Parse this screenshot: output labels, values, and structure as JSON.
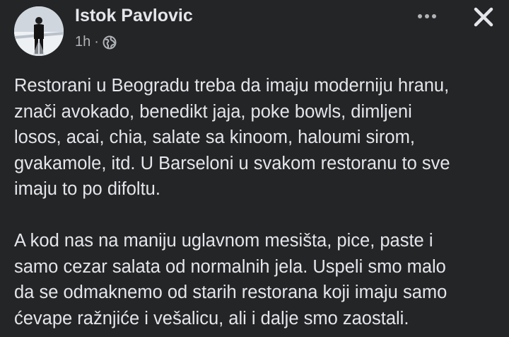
{
  "post": {
    "author": "Istok Pavlovic",
    "time": "1h",
    "separator": "·",
    "audience_icon": "globe-icon",
    "more_icon": "more-horizontal-icon",
    "close_icon": "close-icon",
    "paragraphs": [
      "Restorani u Beogradu treba da imaju moderniju hranu,\nznači avokado, benedikt jaja, poke bowls, dimljeni\nlosos, acai, chia, salate sa kinoom, haloumi sirom,\ngvakamole, itd. U Barseloni u svakom restoranu to sve\nimaju to po difoltu.",
      "A kod nas na maniju uglavnom mesišta, pice, paste i\nsamo cezar salata od normalnih jela. Uspeli smo malo\nda se odmaknemo od starih restorana koji imaju samo\nćevape ražnjiće i vešalicu, ali i dalje smo zaostali."
    ]
  },
  "colors": {
    "background": "#242526",
    "primary_text": "#e4e6eb",
    "secondary_text": "#b0b3b8"
  }
}
